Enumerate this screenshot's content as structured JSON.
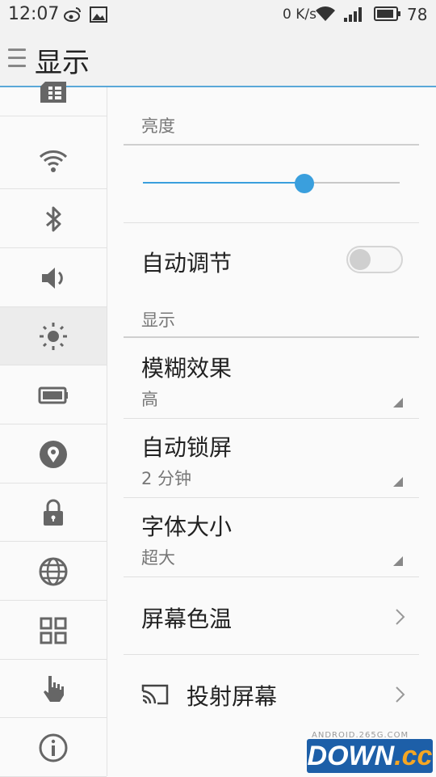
{
  "status_bar": {
    "time": "12:07",
    "speed": "0 K/s",
    "battery_percent": "78",
    "icons": [
      "weibo-icon",
      "image-icon",
      "wifi-icon",
      "signal-icon",
      "battery-icon"
    ]
  },
  "app_bar": {
    "title": "显示",
    "menu_icon": "menu-icon"
  },
  "sidebar": {
    "items": [
      {
        "name": "sim-icon",
        "active": false
      },
      {
        "name": "wifi-icon",
        "active": false
      },
      {
        "name": "bluetooth-icon",
        "active": false
      },
      {
        "name": "volume-icon",
        "active": false
      },
      {
        "name": "brightness-icon",
        "active": true
      },
      {
        "name": "battery-icon",
        "active": false
      },
      {
        "name": "location-icon",
        "active": false
      },
      {
        "name": "lock-icon",
        "active": false
      },
      {
        "name": "globe-icon",
        "active": false
      },
      {
        "name": "apps-grid-icon",
        "active": false
      },
      {
        "name": "gesture-hand-icon",
        "active": false
      },
      {
        "name": "info-icon",
        "active": false
      }
    ]
  },
  "brightness": {
    "header": "亮度",
    "level": 0.63,
    "accent_color": "#3a9fdd"
  },
  "auto_adjust": {
    "label": "自动调节",
    "enabled": false
  },
  "display_section": {
    "header": "显示",
    "blur": {
      "title": "模糊效果",
      "value": "高"
    },
    "auto_lock": {
      "title": "自动锁屏",
      "value": "2 分钟"
    },
    "font_size": {
      "title": "字体大小",
      "value": "超大"
    },
    "color_temp": {
      "title": "屏幕色温"
    },
    "cast": {
      "title": "投射屏幕"
    }
  },
  "watermark": {
    "small": "ANDROID.265G.COM",
    "brand": "DOWN",
    "suffix": ".cc"
  }
}
